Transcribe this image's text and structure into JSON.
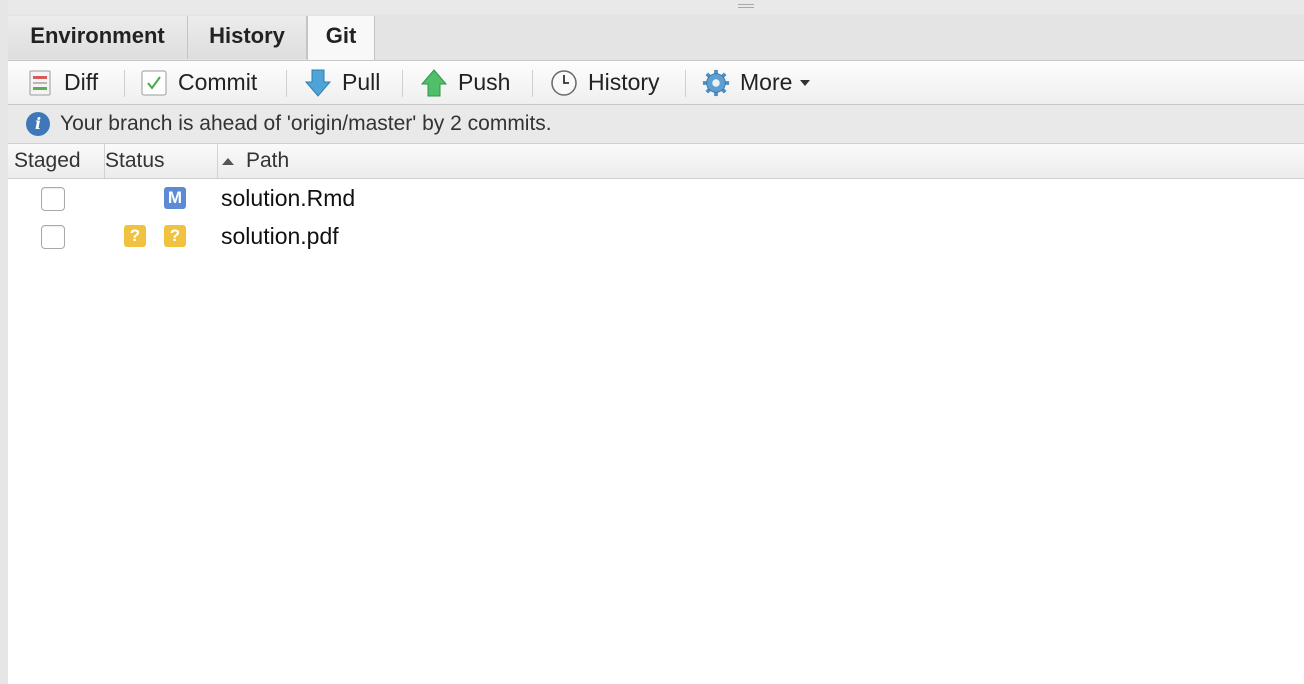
{
  "tabs": [
    {
      "label": "Environment",
      "active": false
    },
    {
      "label": "History",
      "active": false
    },
    {
      "label": "Git",
      "active": true
    }
  ],
  "toolbar": {
    "diff": "Diff",
    "commit": "Commit",
    "pull": "Pull",
    "push": "Push",
    "history": "History",
    "more": "More"
  },
  "info": {
    "message": "Your branch is ahead of 'origin/master' by 2 commits."
  },
  "table": {
    "columns": {
      "staged": "Staged",
      "status": "Status",
      "path": "Path"
    },
    "rows": [
      {
        "staged": false,
        "staged_status": "",
        "unstaged_status": "M",
        "path": "solution.Rmd"
      },
      {
        "staged": false,
        "staged_status": "?",
        "unstaged_status": "?",
        "path": "solution.pdf"
      }
    ]
  },
  "colors": {
    "modified_badge": "#5b8ad6",
    "untracked_badge": "#f0c240",
    "info_icon": "#3f78b8"
  }
}
